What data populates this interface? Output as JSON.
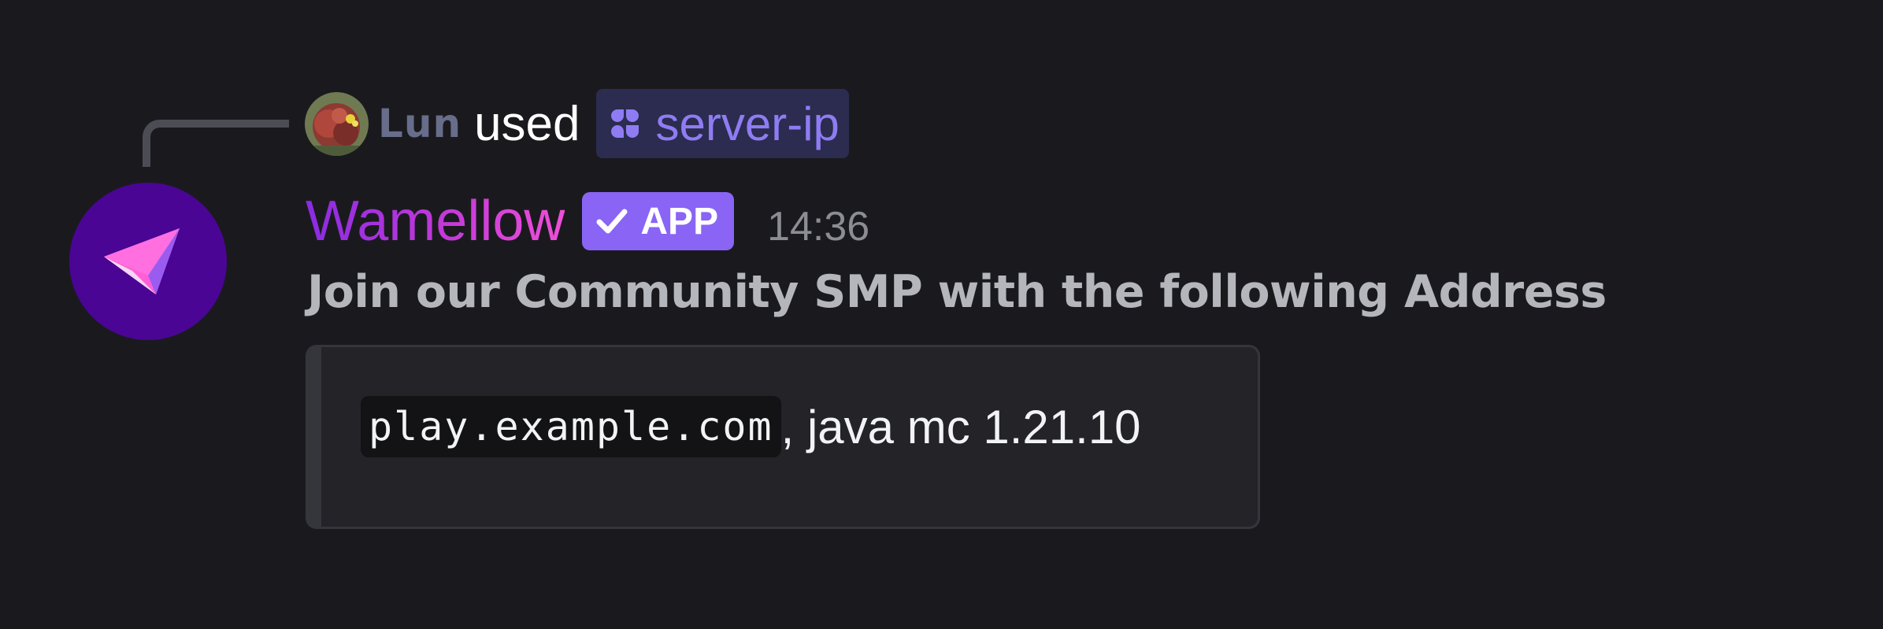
{
  "reply": {
    "username": "Lun",
    "verb": "used",
    "command_name": "server-ip"
  },
  "message": {
    "author": "Wamellow",
    "badge": "APP",
    "timestamp": "14:36",
    "text": "Join our Community SMP with the following Address",
    "embed": {
      "code": "play.example.com",
      "suffix": ", java mc 1.21.10"
    }
  },
  "icons": {
    "reply_avatar": "user-avatar",
    "command": "app-command-icon",
    "badge": "check-icon",
    "bot_avatar": "wamellow-logo"
  },
  "colors": {
    "background": "#1a1a1e",
    "command_chip_bg": "#2b2c4f",
    "command_text": "#8f7cf3",
    "badge_bg": "#8964f5",
    "bot_avatar_bg": "#4a0594",
    "author_gradient_start": "#8a2be2",
    "author_gradient_end": "#ee4fd8",
    "embed_bg": "#232328",
    "embed_border": "#35363c"
  }
}
